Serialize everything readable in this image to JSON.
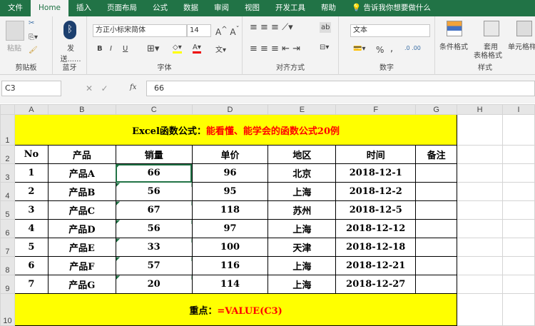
{
  "tabs": [
    "文件",
    "Home",
    "插入",
    "页面布局",
    "公式",
    "数据",
    "审阅",
    "视图",
    "开发工具",
    "帮助"
  ],
  "tell_me": "告诉我你想要做什么",
  "ribbon": {
    "paste": "粘贴",
    "clipboard": "剪贴板",
    "bt_send": "发送......",
    "bluetooth": "蓝牙",
    "font_name": "方正小标宋简体",
    "font_size": "14",
    "font_group": "字体",
    "align_group": "对齐方式",
    "number_format": "文本",
    "number_group": "数字",
    "cond_format": "条件格式",
    "table_format_1": "套用",
    "table_format_2": "表格格式",
    "cell_style": "单元格样式",
    "styles_group": "样式",
    "bold": "B",
    "italic": "I",
    "underline": "U",
    "percent": "%",
    "comma": ","
  },
  "formula_bar": {
    "cell": "C3",
    "value": "66",
    "fx": "fx"
  },
  "columns": [
    "A",
    "B",
    "C",
    "D",
    "E",
    "F",
    "G",
    "H",
    "I"
  ],
  "rows": [
    "1",
    "2",
    "3",
    "4",
    "5",
    "6",
    "7",
    "8",
    "9",
    "10"
  ],
  "title": {
    "black": "Excel函数公式：",
    "red": "能看懂、能学会的函数公式20例"
  },
  "headers": [
    "No",
    "产品",
    "销量",
    "单价",
    "地区",
    "时间",
    "备注"
  ],
  "data": [
    [
      "1",
      "产品A",
      "66",
      "96",
      "北京",
      "2018-12-1",
      ""
    ],
    [
      "2",
      "产品B",
      "56",
      "95",
      "上海",
      "2018-12-2",
      ""
    ],
    [
      "3",
      "产品C",
      "67",
      "118",
      "苏州",
      "2018-12-5",
      ""
    ],
    [
      "4",
      "产品D",
      "56",
      "97",
      "上海",
      "2018-12-12",
      ""
    ],
    [
      "5",
      "产品E",
      "33",
      "100",
      "天津",
      "2018-12-18",
      ""
    ],
    [
      "6",
      "产品F",
      "57",
      "116",
      "上海",
      "2018-12-21",
      ""
    ],
    [
      "7",
      "产品G",
      "20",
      "114",
      "上海",
      "2018-12-27",
      ""
    ]
  ],
  "footer": {
    "label": "重点：",
    "formula": "=VALUE(C3)"
  }
}
